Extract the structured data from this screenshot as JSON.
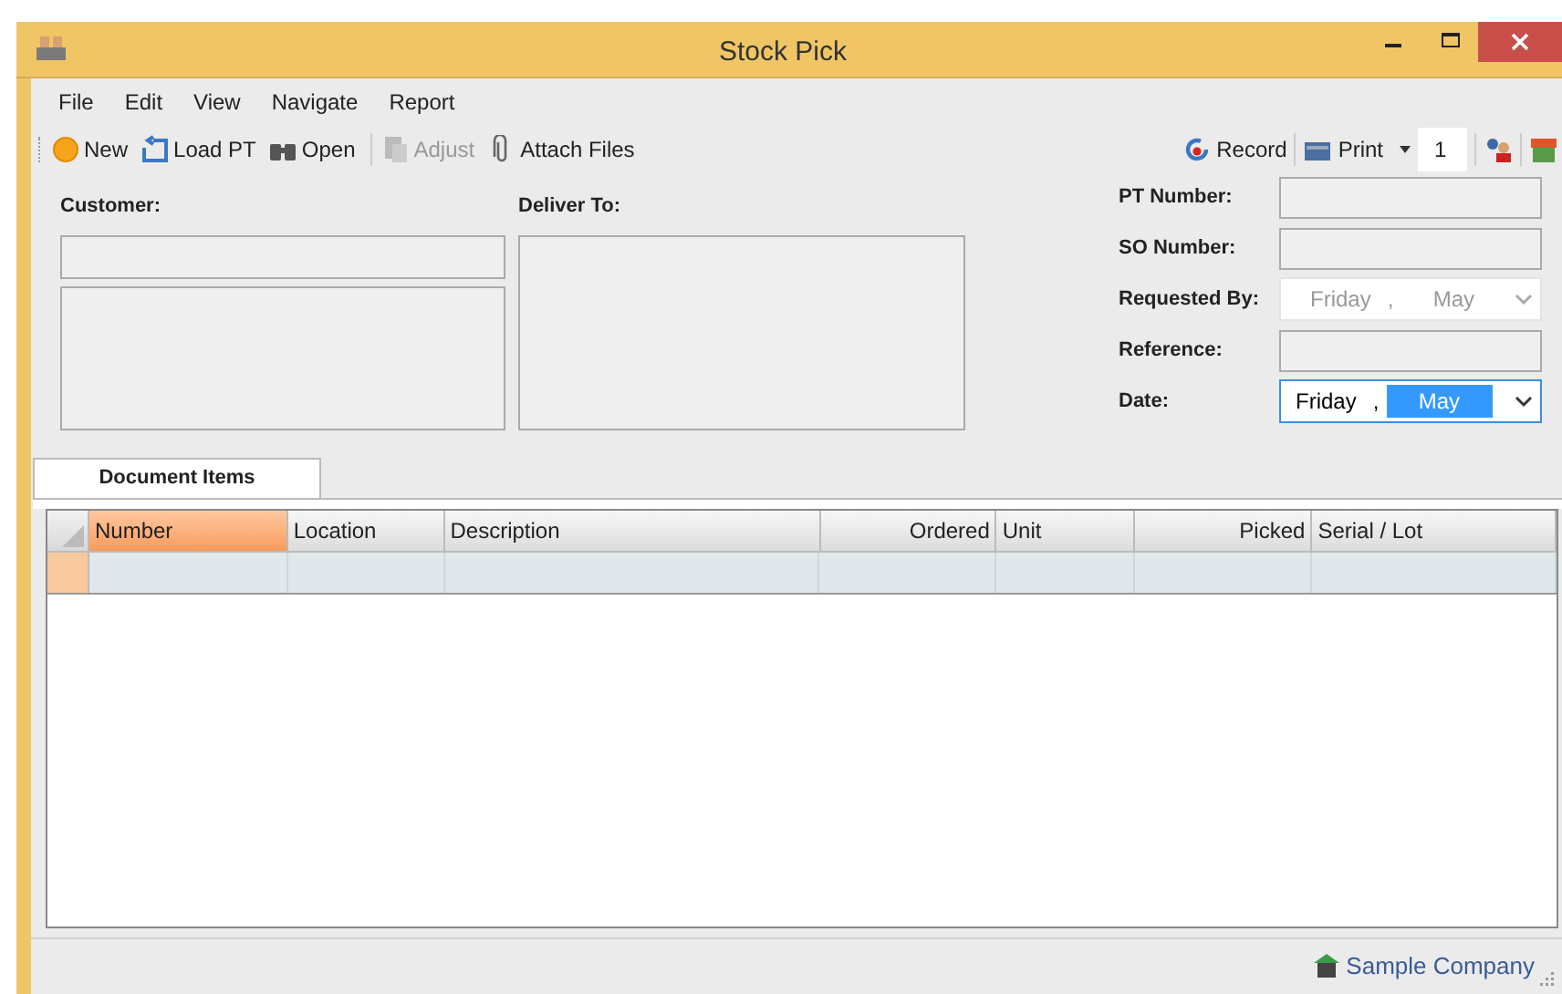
{
  "window": {
    "title": "Stock Pick"
  },
  "menu": [
    "File",
    "Edit",
    "View",
    "Navigate",
    "Report"
  ],
  "toolbar_left": [
    {
      "label": "New",
      "disabled": false
    },
    {
      "label": "Load PT",
      "disabled": false
    },
    {
      "label": "Open",
      "disabled": false
    },
    {
      "label": "Adjust",
      "disabled": true
    },
    {
      "label": "Attach Files",
      "disabled": false
    }
  ],
  "toolbar_right": {
    "record": "Record",
    "print": "Print",
    "copies": "1"
  },
  "customer": {
    "label": "Customer:"
  },
  "deliver_to": {
    "label": "Deliver To:"
  },
  "fields": [
    {
      "kind": "text",
      "label": "PT Number:"
    },
    {
      "kind": "text",
      "label": "SO Number:"
    },
    {
      "kind": "date",
      "label": "Requested By:",
      "day": "Friday",
      "separator": ",",
      "month": "May",
      "disabled": true,
      "month_selected": false
    },
    {
      "kind": "text",
      "label": "Reference:"
    },
    {
      "kind": "date",
      "label": "Date:",
      "day": "Friday",
      "separator": ",",
      "month": "May",
      "disabled": false,
      "month_selected": true
    }
  ],
  "tabs": [
    {
      "label": "Document Items",
      "selected": true
    }
  ],
  "table": {
    "columns": [
      {
        "label": "Number",
        "numeric": false,
        "selected": true
      },
      {
        "label": "Location",
        "numeric": false,
        "selected": false
      },
      {
        "label": "Description",
        "numeric": false,
        "selected": false
      },
      {
        "label": "Ordered",
        "numeric": true,
        "selected": false
      },
      {
        "label": "Unit",
        "numeric": false,
        "selected": false
      },
      {
        "label": "Picked",
        "numeric": true,
        "selected": false
      },
      {
        "label": "Serial / Lot",
        "numeric": false,
        "selected": false
      }
    ]
  },
  "status_bar": {
    "company": "Sample Company"
  }
}
